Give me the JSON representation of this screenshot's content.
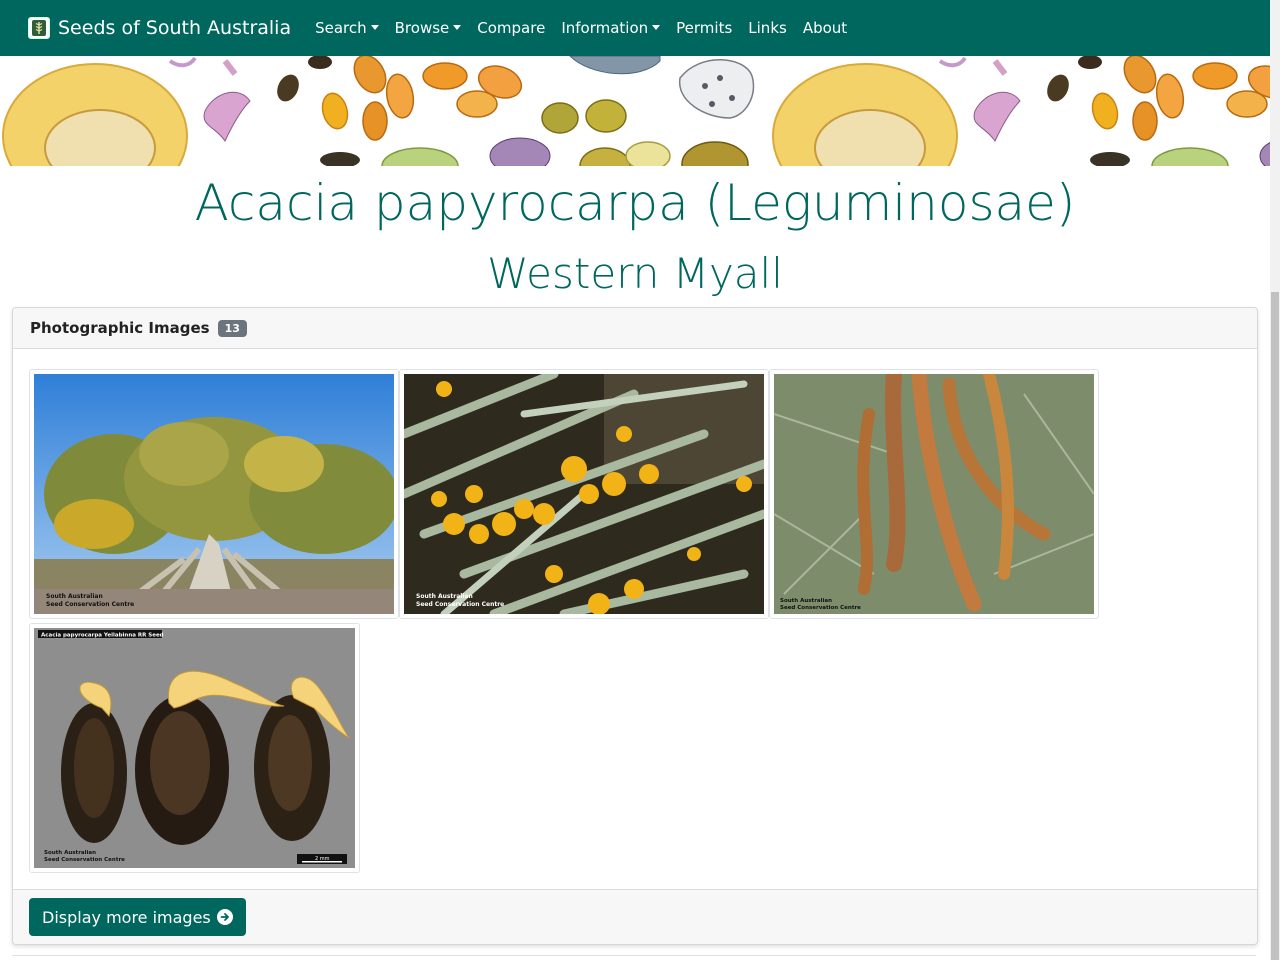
{
  "navbar": {
    "brand": "Seeds of South Australia",
    "items": [
      {
        "label": "Search",
        "dropdown": true
      },
      {
        "label": "Browse",
        "dropdown": true
      },
      {
        "label": "Compare",
        "dropdown": false
      },
      {
        "label": "Information",
        "dropdown": true
      },
      {
        "label": "Permits",
        "dropdown": false
      },
      {
        "label": "Links",
        "dropdown": false
      },
      {
        "label": "About",
        "dropdown": false
      }
    ],
    "bg_color": "#00675e"
  },
  "species": {
    "title": "Acacia papyrocarpa (Leguminosae)",
    "common_name": "Western Myall"
  },
  "photos": {
    "header": "Photographic Images",
    "count": "13",
    "images": [
      {
        "subject": "tree-habit",
        "credit_line1": "South Australian",
        "credit_line2": "Seed Conservation Centre"
      },
      {
        "subject": "flowers",
        "credit_line1": "South Australian",
        "credit_line2": "Seed Conservation Centre"
      },
      {
        "subject": "pods",
        "credit_line1": "South Australian",
        "credit_line2": "Seed Conservation Centre"
      },
      {
        "subject": "seeds",
        "caption": "Acacia papyrocarpa Yellabinna RR Seed",
        "credit_line1": "South Australian",
        "credit_line2": "Seed Conservation Centre",
        "scale": "2 mm"
      }
    ],
    "more_button": "Display more images"
  }
}
